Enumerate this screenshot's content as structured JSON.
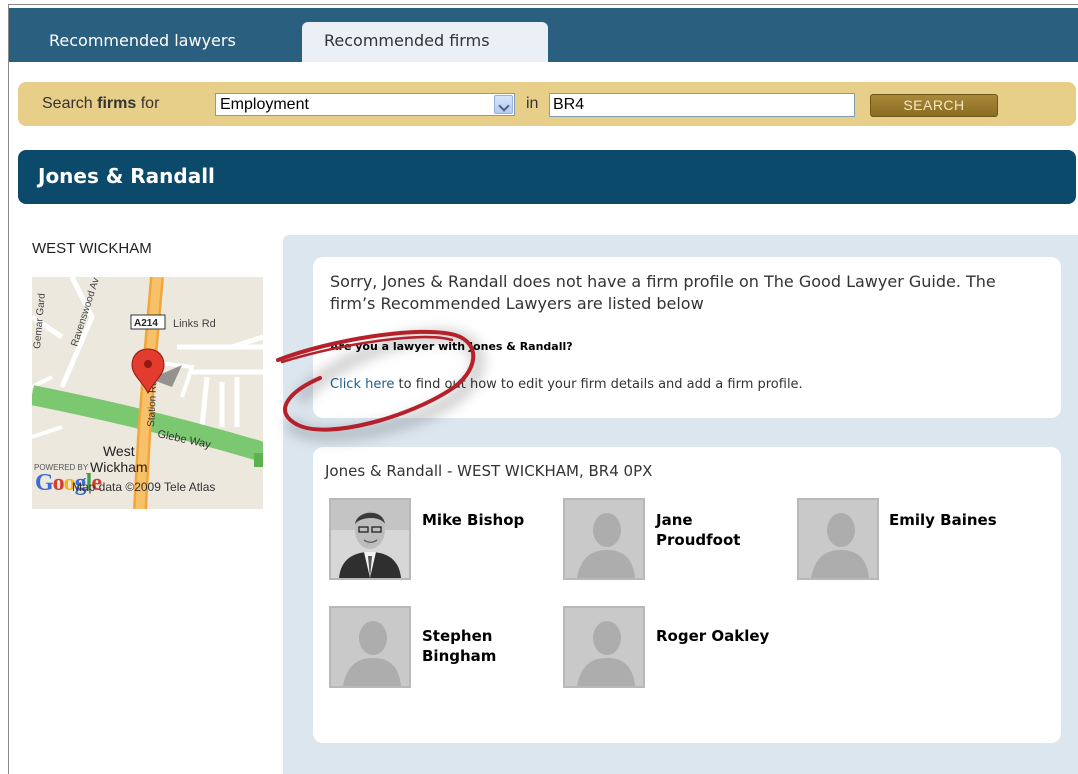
{
  "tabs": [
    {
      "label": "Recommended lawyers",
      "active": false
    },
    {
      "label": "Recommended firms",
      "active": true
    }
  ],
  "search": {
    "label_prefix": "Search",
    "label_bold": "firms",
    "label_suffix": "for",
    "practice_area": "Employment",
    "in_label": "in",
    "location": "BR4",
    "button_label": "SEARCH"
  },
  "firm": {
    "name": "Jones & Randall",
    "town": "WEST WICKHAM"
  },
  "map": {
    "road_a214": "A214",
    "links_rd": "Links Rd",
    "ravenswood": "Ravenswood Av",
    "gemar_gard": "Gemar Gard",
    "station_rd": "Station Rd",
    "glebe_way": "Glebe Way",
    "town_line1": "West",
    "town_line2": "Wickham",
    "powered_by": "POWERED BY",
    "google": "Google",
    "credit": "Map data ©2009 Tele Atlas"
  },
  "notice": {
    "text": "Sorry, Jones & Randall does not have a firm profile on The Good Lawyer Guide. The firm’s Recommended Lawyers are listed below",
    "question": "Are you a lawyer with Jones & Randall?",
    "link_text": "Click here",
    "link_suffix": " to find out how to edit your firm details and add a firm profile."
  },
  "lawyers_section": {
    "heading": "Jones & Randall - WEST WICKHAM, BR4 0PX",
    "lawyers": [
      {
        "name": "Mike Bishop",
        "has_photo": true
      },
      {
        "name": "Jane Proudfoot",
        "has_photo": false
      },
      {
        "name": "Emily Baines",
        "has_photo": false
      },
      {
        "name": "Stephen Bingham",
        "has_photo": false
      },
      {
        "name": "Roger Oakley",
        "has_photo": false
      }
    ]
  },
  "colors": {
    "tab_bar": "#2b5f80",
    "search_bar": "#e7cf8a",
    "firm_banner": "#0c4a6b",
    "panel": "#dce6ef",
    "annotation": "#b5202a"
  },
  "icons": [
    "map-pin-icon",
    "dropdown-arrow-icon",
    "placeholder-avatar-icon"
  ]
}
